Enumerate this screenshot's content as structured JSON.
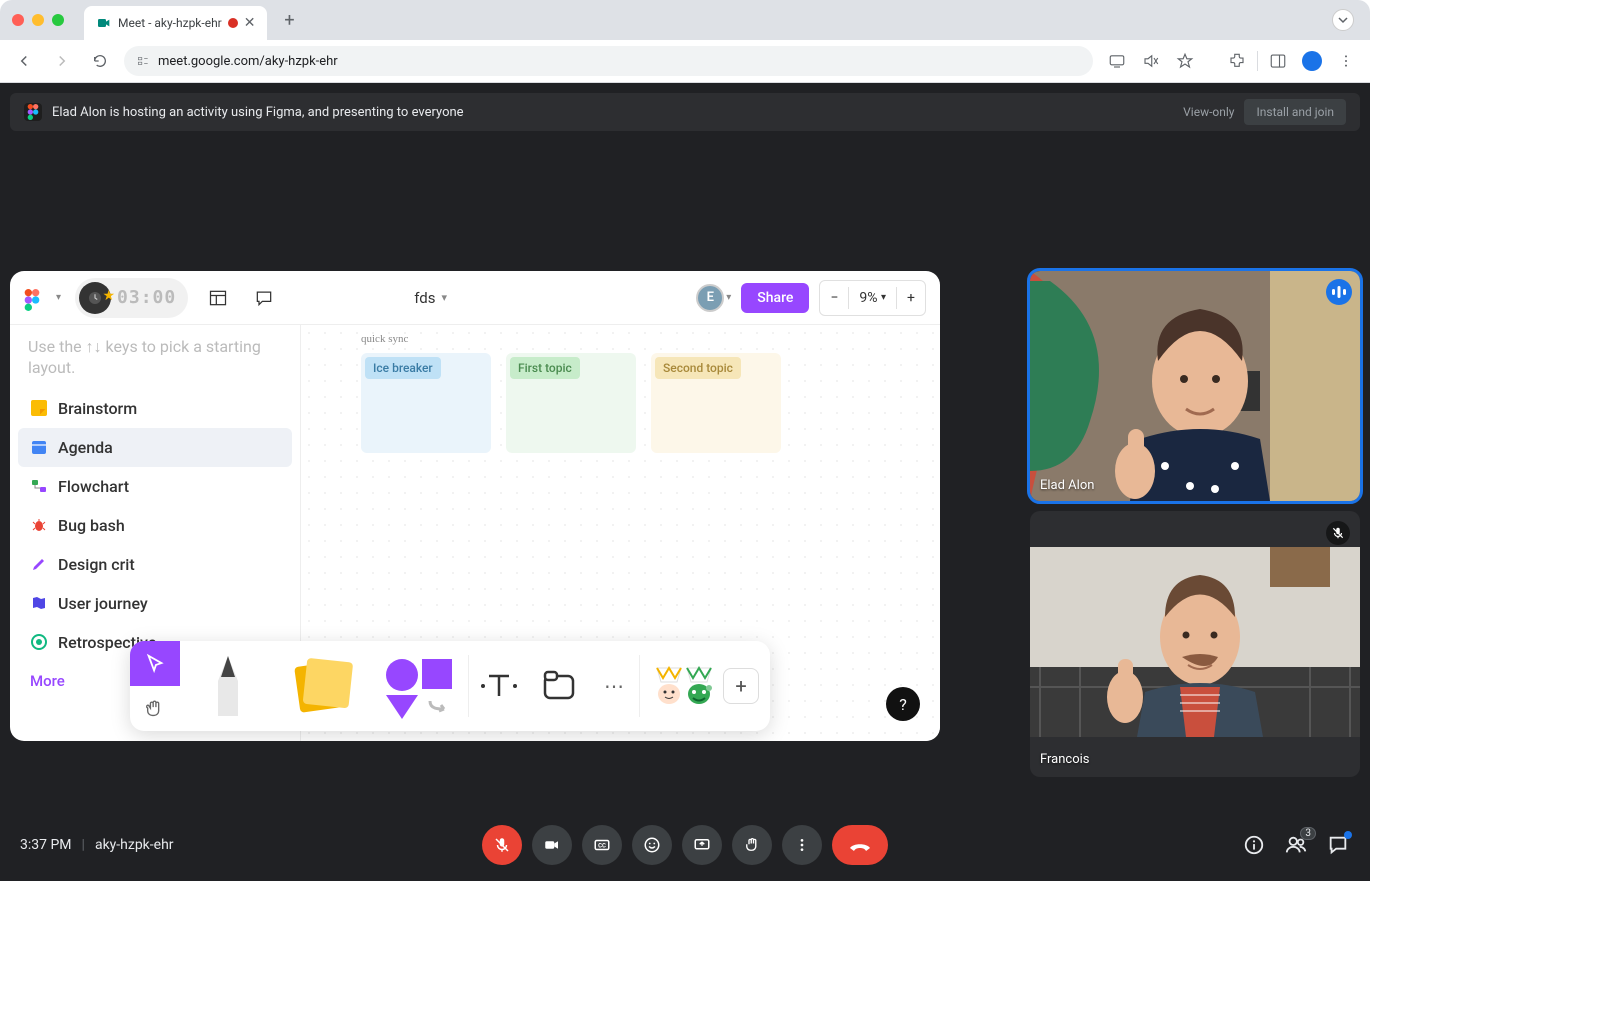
{
  "browser": {
    "tab_title": "Meet - aky-hzpk-ehr",
    "url": "meet.google.com/aky-hzpk-ehr"
  },
  "banner": {
    "text": "Elad Alon is hosting an activity using Figma, and presenting to everyone",
    "view_only": "View-only",
    "install": "Install and join"
  },
  "figjam": {
    "timer": "03:00",
    "title": "fds",
    "avatar_initial": "E",
    "share": "Share",
    "zoom": "9%",
    "hint": "Use the ↑↓ keys to pick a starting layout.",
    "items": [
      {
        "label": "Brainstorm",
        "icon": "note-icon",
        "color": "#f4b400"
      },
      {
        "label": "Agenda",
        "icon": "calendar-icon",
        "color": "#4285f4",
        "selected": true
      },
      {
        "label": "Flowchart",
        "icon": "flowchart-icon",
        "color": "#34a853"
      },
      {
        "label": "Bug bash",
        "icon": "bug-icon",
        "color": "#ea4335"
      },
      {
        "label": "Design crit",
        "icon": "pen-icon",
        "color": "#9747ff"
      },
      {
        "label": "User journey",
        "icon": "map-icon",
        "color": "#4f46e5"
      },
      {
        "label": "Retrospective",
        "icon": "target-icon",
        "color": "#10b981"
      }
    ],
    "more": "More",
    "canvas": {
      "title": "quick sync",
      "cards": [
        "Ice breaker",
        "First topic",
        "Second topic"
      ]
    },
    "help": "?"
  },
  "participants": [
    {
      "name": "Elad Alon",
      "speaking": true,
      "muted": false
    },
    {
      "name": "Francois",
      "speaking": false,
      "muted": true
    }
  ],
  "meet_bar": {
    "time": "3:37 PM",
    "code": "aky-hzpk-ehr",
    "people_count": "3"
  }
}
